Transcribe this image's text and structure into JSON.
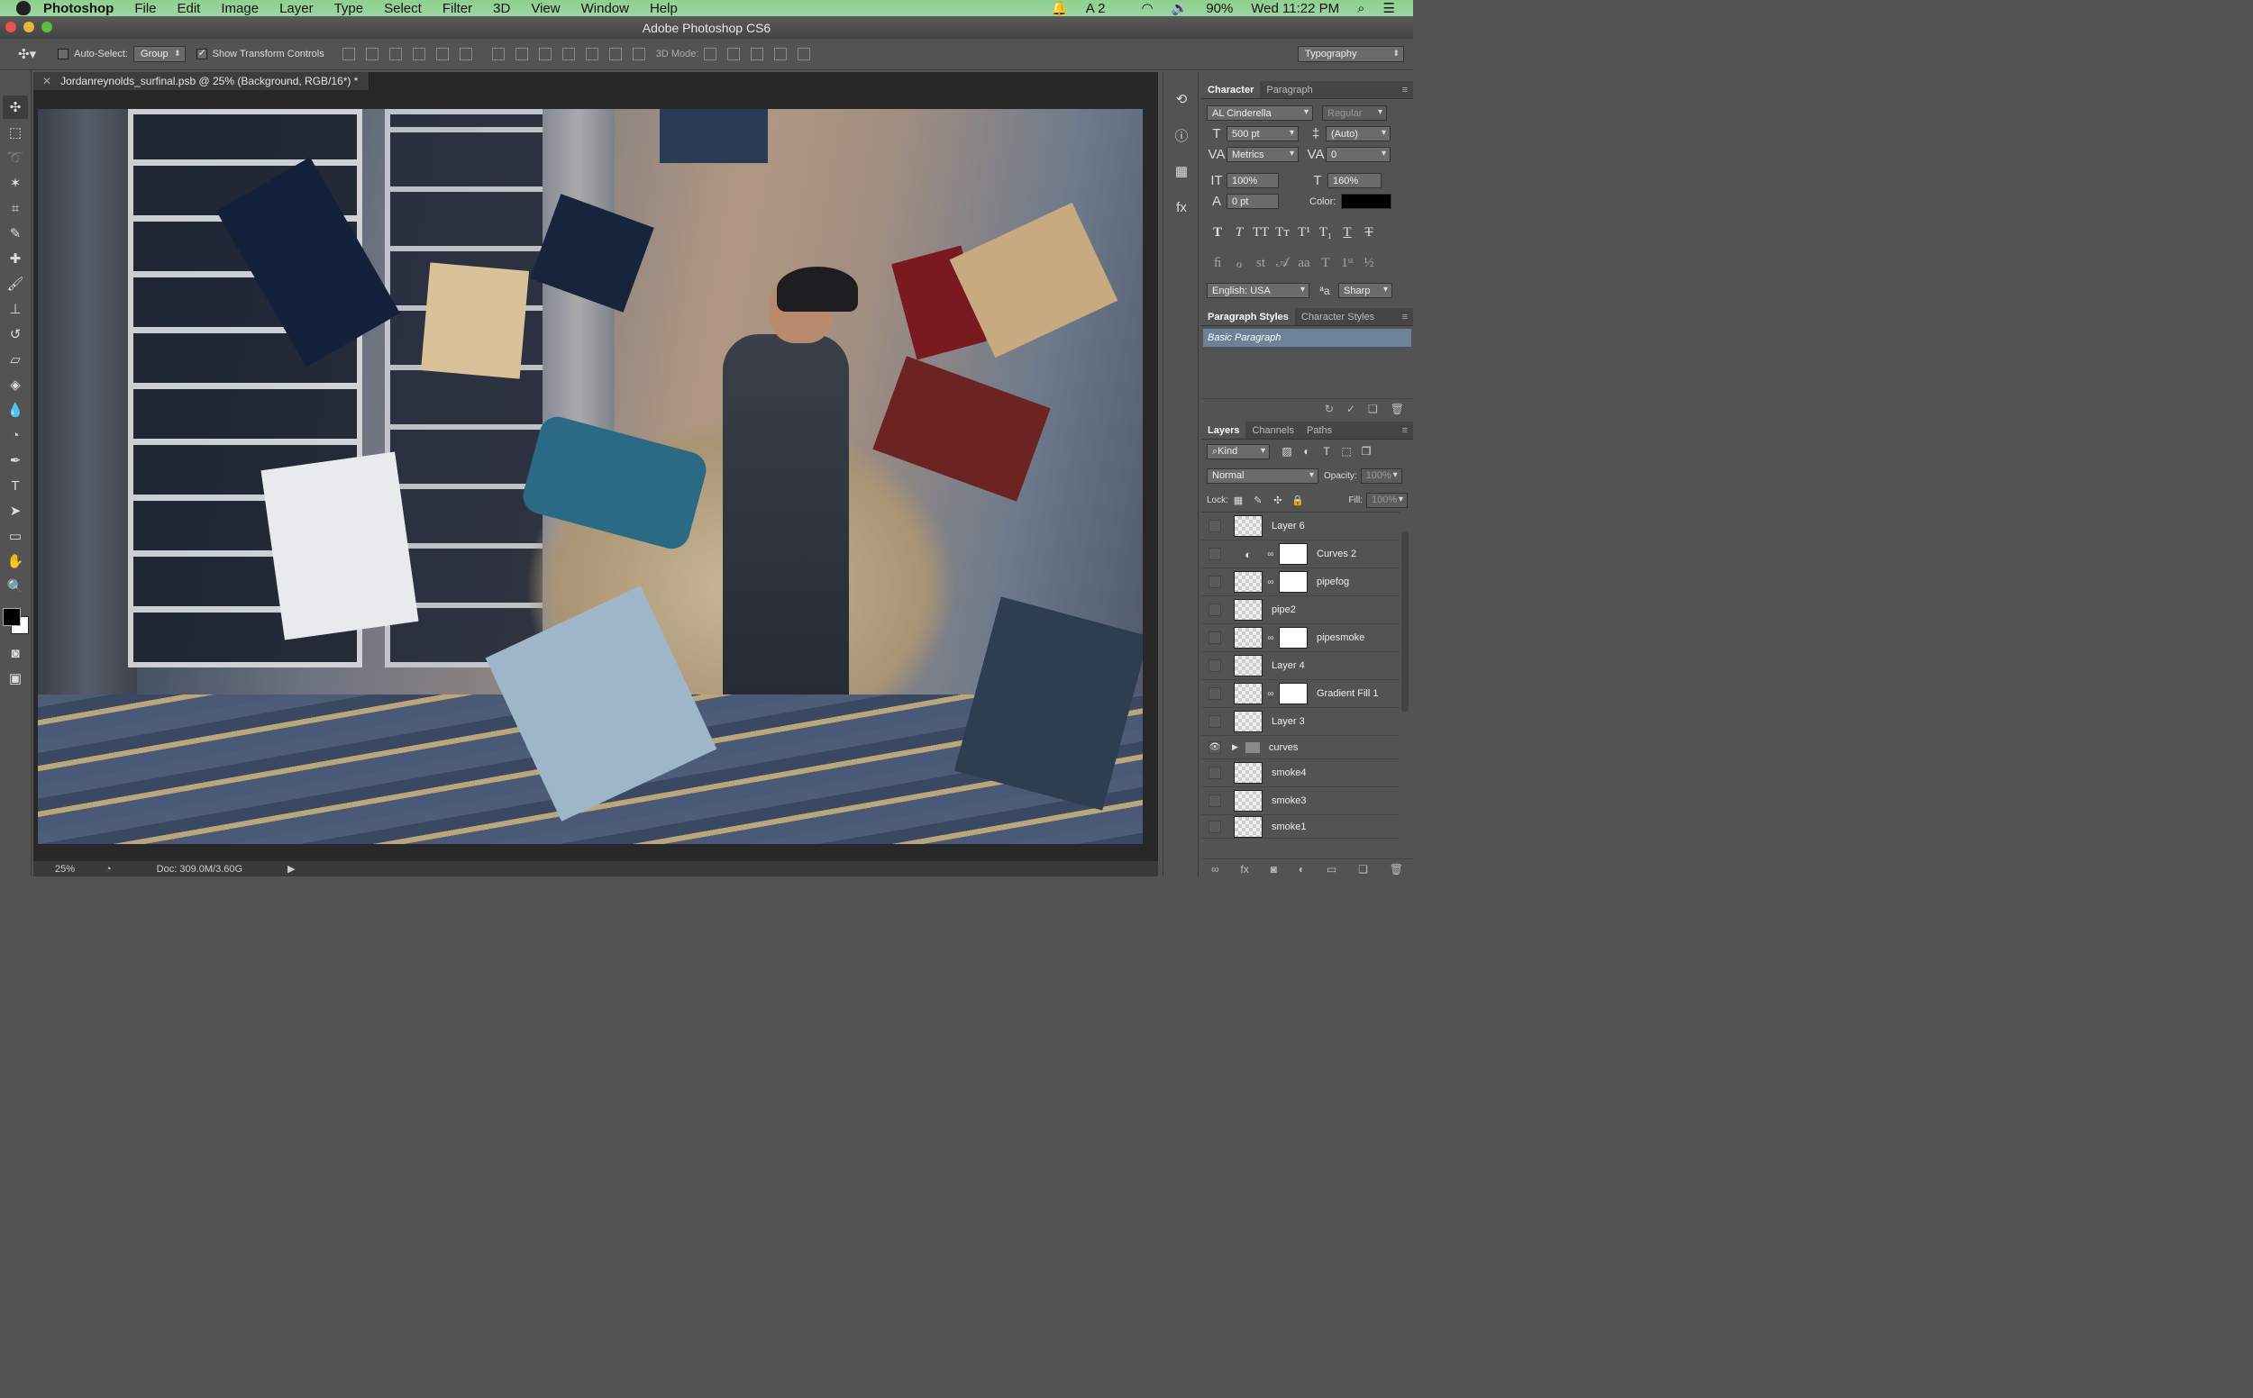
{
  "menubar": {
    "app": "Photoshop",
    "items": [
      "File",
      "Edit",
      "Image",
      "Layer",
      "Type",
      "Select",
      "Filter",
      "3D",
      "View",
      "Window",
      "Help"
    ],
    "status_ai": "2",
    "battery": "90%",
    "clock": "Wed 11:22 PM"
  },
  "window": {
    "title": "Adobe Photoshop CS6"
  },
  "options": {
    "auto_select_label": "Auto-Select:",
    "auto_select_mode": "Group",
    "show_transform_label": "Show Transform Controls",
    "mode_3d_label": "3D Mode:",
    "workspace": "Typography"
  },
  "document": {
    "tab_title": "Jordanreynolds_surfinal.psb @ 25% (Background, RGB/16*) *",
    "zoom": "25%",
    "doc_info": "Doc: 309.0M/3.60G"
  },
  "character": {
    "tabs": [
      "Character",
      "Paragraph"
    ],
    "font_family": "AL Cinderella",
    "font_style": "Regular",
    "size": "500 pt",
    "leading": "(Auto)",
    "kerning": "Metrics",
    "tracking": "0",
    "vscale": "100%",
    "hscale": "160%",
    "baseline": "0 pt",
    "color_label": "Color:",
    "language": "English: USA",
    "aa_label": "a",
    "antialias": "Sharp"
  },
  "para_styles": {
    "tabs": [
      "Paragraph Styles",
      "Character Styles"
    ],
    "selected": "Basic Paragraph"
  },
  "layers": {
    "tabs": [
      "Layers",
      "Channels",
      "Paths"
    ],
    "filter": "Kind",
    "blend": "Normal",
    "opacity_label": "Opacity:",
    "opacity": "100%",
    "lock_label": "Lock:",
    "fill_label": "Fill:",
    "fill": "100%",
    "items": [
      {
        "name": "Layer 6"
      },
      {
        "name": "Curves 2"
      },
      {
        "name": "pipefog"
      },
      {
        "name": "pipe2"
      },
      {
        "name": "pipesmoke"
      },
      {
        "name": "Layer 4"
      },
      {
        "name": "Gradient Fill 1"
      },
      {
        "name": "Layer 3"
      },
      {
        "name": "curves"
      },
      {
        "name": "smoke4"
      },
      {
        "name": "smoke3"
      },
      {
        "name": "smoke1"
      }
    ]
  },
  "colors": {
    "accent_selection": "#6d8299",
    "foreground": "#000000",
    "background": "#ffffff"
  }
}
